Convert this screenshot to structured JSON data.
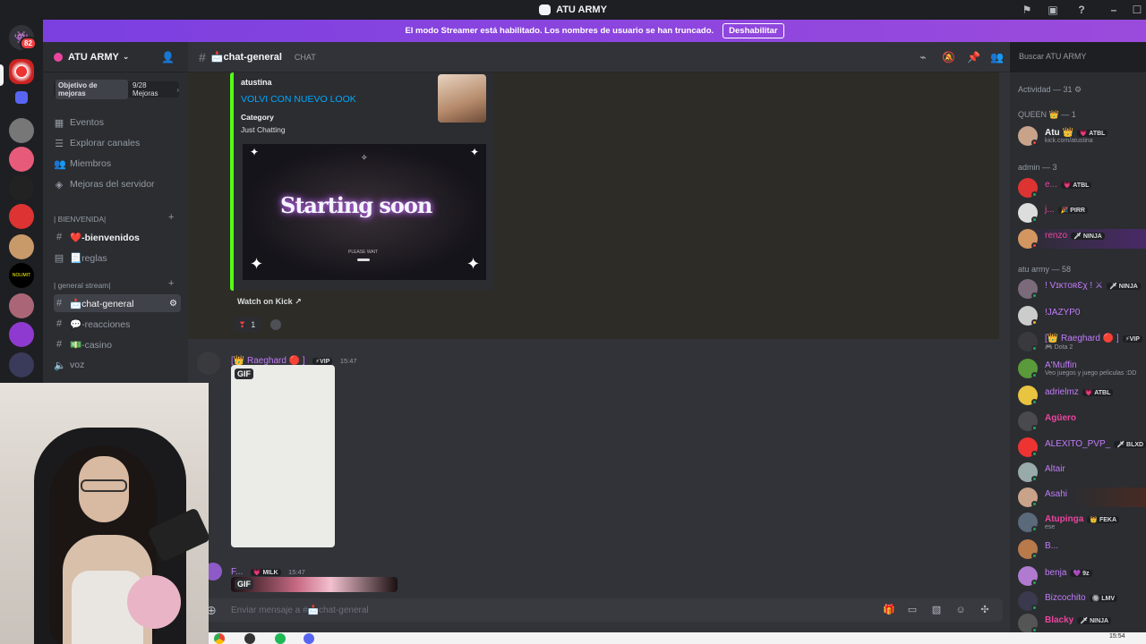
{
  "window": {
    "title": "ATU ARMY"
  },
  "banner": {
    "text": "El modo Streamer está habilitado. Los nombres de usuario se han truncado.",
    "button": "Deshabilitar"
  },
  "rail": {
    "badge": "82"
  },
  "server": {
    "name": "ATU ARMY",
    "boost_label": "Objetivo de mejoras",
    "boost_progress": "9/28 Mejoras",
    "links": [
      "Eventos",
      "Explorar canales",
      "Miembros",
      "Mejoras del servidor"
    ],
    "categories": [
      "| BIENVENIDA|",
      "| general stream|"
    ],
    "channels": [
      {
        "name": "❤️-bienvenidos"
      },
      {
        "name": "📃reglas"
      },
      {
        "name": "📩chat-general"
      },
      {
        "name": "💬-reacciones"
      },
      {
        "name": "💵-casino"
      },
      {
        "name": "voz"
      }
    ]
  },
  "header": {
    "channel": "📩chat-general",
    "type": "CHAT",
    "search_placeholder": "Buscar ATU ARMY"
  },
  "embed": {
    "author": "atustina",
    "title": "VOLVI CON NUEVO LOOK",
    "field_name": "Category",
    "field_value": "Just Chatting",
    "preview_text": "Starting soon",
    "preview_wait": "PLEASE WAIT",
    "watch_label": "Watch on Kick",
    "reaction_count": "1"
  },
  "messages": [
    {
      "user": "[👑 Raeghard 🔴 ]",
      "tag": "⚡VIP",
      "time": "15:47",
      "gif": "GIF"
    },
    {
      "user": "F...",
      "tag": "💗 MILK",
      "time": "15:47",
      "gif": "GIF"
    }
  ],
  "composer": {
    "placeholder": "Enviar mensaje a #📩chat-general"
  },
  "members": {
    "activity": "Actividad — 31",
    "groups": [
      {
        "title": "QUEEN 👑 — 1",
        "members": [
          {
            "name": "Atu 👑",
            "tag": "💗 ATBL",
            "sub": "kick.com/atustina",
            "color": "#f2f3f5"
          }
        ]
      },
      {
        "title": "admin — 3",
        "members": [
          {
            "name": "e...",
            "tag": "💗 ATBL",
            "color": "#eb459e"
          },
          {
            "name": "j...",
            "tag": "🎉 PIRR",
            "color": "#eb459e"
          },
          {
            "name": "renzo",
            "tag": "🗡 NINJA",
            "color": "#eb459e"
          }
        ]
      },
      {
        "title": "atu army — 58",
        "members": [
          {
            "name": "! VɪᴋᴛᴏʀƐχ ! ⚔",
            "tag": "🗡 NINJA",
            "color": "#c27cfa"
          },
          {
            "name": "!JAZYP0",
            "color": "#c27cfa"
          },
          {
            "name": "[👑 Raeghard 🔴 ]",
            "tag": "⚡VIP",
            "sub": "🎮 Dota 2",
            "color": "#c27cfa"
          },
          {
            "name": "A'Muffin",
            "sub": "Veo juegos y juego peliculas :DD",
            "color": "#c27cfa"
          },
          {
            "name": "adrielmz",
            "tag": "💗 ATBL",
            "color": "#c27cfa"
          },
          {
            "name": "Agüero",
            "color": "#eb459e"
          },
          {
            "name": "ALEXITO_PVP_",
            "tag": "🗡 BLXD",
            "color": "#c27cfa"
          },
          {
            "name": "Altair",
            "color": "#c27cfa"
          },
          {
            "name": "Asahi",
            "color": "#c27cfa"
          },
          {
            "name": "Atupinga",
            "tag": "👑 FEKA",
            "sub": "ese",
            "color": "#eb459e"
          },
          {
            "name": "B...",
            "color": "#c27cfa"
          },
          {
            "name": "benja",
            "tag": "💜 9z",
            "color": "#c27cfa"
          },
          {
            "name": "Bizcochito",
            "tag": "🔘 LMV",
            "color": "#c27cfa"
          },
          {
            "name": "Blacky",
            "tag": "🗡 NINJA",
            "color": "#eb459e"
          }
        ]
      }
    ]
  },
  "taskbar": {
    "clock": "15:54"
  }
}
